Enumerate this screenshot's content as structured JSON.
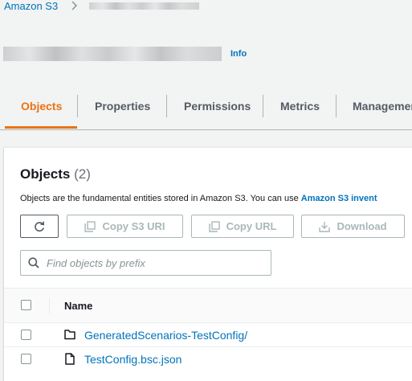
{
  "breadcrumb": {
    "root": "Amazon S3"
  },
  "header": {
    "info_label": "Info"
  },
  "tabs": [
    {
      "label": "Objects",
      "active": true
    },
    {
      "label": "Properties",
      "active": false
    },
    {
      "label": "Permissions",
      "active": false
    },
    {
      "label": "Metrics",
      "active": false
    },
    {
      "label": "Managemen",
      "active": false
    }
  ],
  "objects_panel": {
    "title": "Objects",
    "count": "(2)",
    "description": "Objects are the fundamental entities stored in Amazon S3. You can use ",
    "description_link": "Amazon S3 invent",
    "toolbar": {
      "refresh_icon": "refresh-icon",
      "copy_s3_uri": "Copy S3 URI",
      "copy_url": "Copy URL",
      "download": "Download"
    },
    "search": {
      "placeholder": "Find objects by prefix",
      "value": ""
    },
    "table": {
      "columns": [
        "Name"
      ],
      "rows": [
        {
          "type": "folder",
          "icon": "folder-icon",
          "name": "GeneratedScenarios-TestConfig/"
        },
        {
          "type": "file",
          "icon": "file-icon",
          "name": "TestConfig.bsc.json"
        }
      ]
    }
  },
  "colors": {
    "link": "#0073bb",
    "active_tab": "#ec7211",
    "text": "#16191f",
    "muted": "#545b64",
    "disabled": "#aab7b8",
    "background": "#f2f3f3"
  }
}
